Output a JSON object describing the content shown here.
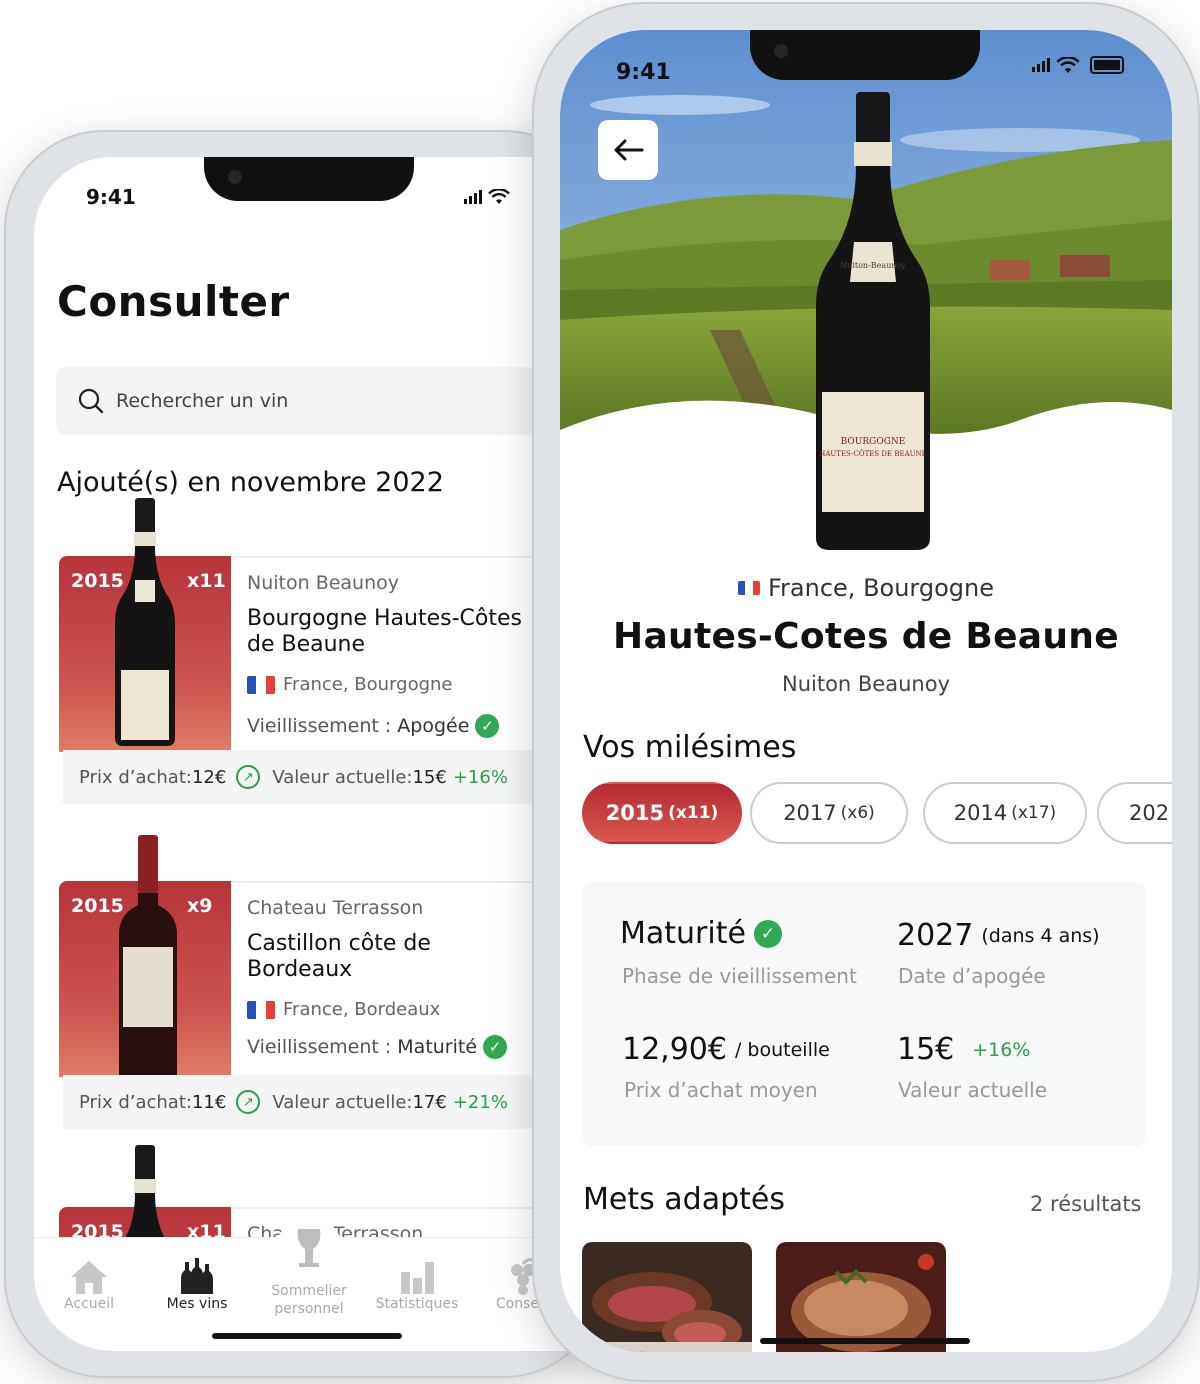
{
  "left_screen": {
    "status_time": "9:41",
    "title": "Consulter",
    "search": {
      "placeholder": "Rechercher un vin"
    },
    "section_title": "Ajouté(s) en novembre 2022",
    "wines": [
      {
        "year": "2015",
        "qty": "x11",
        "producer": "Nuiton Beaunoy",
        "name": "Bourgogne Hautes-Côtes\nde Beaune",
        "origin": "France, Bourgogne",
        "aging_label": "Vieillissement : ",
        "aging_value": "Apogée",
        "purchase_label": "Prix d’achat: ",
        "purchase_price": "12€",
        "value_label": "Valeur actuelle: ",
        "value": "15€",
        "change": "+16%"
      },
      {
        "year": "2015",
        "qty": "x9",
        "producer": "Chateau Terrasson",
        "name": "Castillon côte de\nBordeaux",
        "origin": "France, Bordeaux",
        "aging_label": "Vieillissement : ",
        "aging_value": "Maturité",
        "purchase_label": "Prix d’achat: ",
        "purchase_price": "11€",
        "value_label": "Valeur actuelle: ",
        "value": "17€",
        "change": "+21%"
      },
      {
        "year": "2015",
        "qty": "x11",
        "producer": "Chateau Terrasson"
      }
    ],
    "tabs": [
      {
        "label": "Accueil",
        "icon": "home-icon"
      },
      {
        "label": "Mes vins",
        "icon": "bottles-icon"
      },
      {
        "label": "Sommelier personnel",
        "icon": "wine-glass-icon"
      },
      {
        "label": "Statistiques",
        "icon": "bar-chart-icon"
      },
      {
        "label": "Conseils",
        "icon": "grapes-icon"
      }
    ]
  },
  "right_screen": {
    "status_time": "9:41",
    "origin": "France, Bourgogne",
    "wine_name": "Hautes-Cotes de Beaune",
    "producer": "Nuiton Beaunoy",
    "label_text": {
      "top": "Nuiton-Beaunoy",
      "line1": "BOURGOGNE",
      "line2": "HAUTES-CÔTES DE BEAUNE"
    },
    "vintages_title": "Vos milésimes",
    "vintages": [
      {
        "year": "2015",
        "qty": "(x11)",
        "selected": true
      },
      {
        "year": "2017",
        "qty": "(x6)",
        "selected": false
      },
      {
        "year": "2014",
        "qty": "(x17)",
        "selected": false
      },
      {
        "year": "202",
        "qty": "",
        "selected": false
      }
    ],
    "stats": {
      "maturity": {
        "value": "Maturité",
        "label": "Phase de vieillissement"
      },
      "peak": {
        "value": "2027",
        "suffix": "(dans 4 ans)",
        "label": "Date d’apogée"
      },
      "avg_price": {
        "value": "12,90€",
        "suffix": "/ bouteille",
        "label": "Prix d’achat moyen"
      },
      "current": {
        "value": "15€",
        "change": "+16%",
        "label": "Valeur actuelle"
      }
    },
    "pairings_title": "Mets adaptés",
    "pairings_count": "2 résultats"
  },
  "colors": {
    "accent": "#c0393b",
    "positive": "#2f9e4a",
    "flag_blue": "#2b4fb8",
    "flag_red": "#e63e3e"
  }
}
